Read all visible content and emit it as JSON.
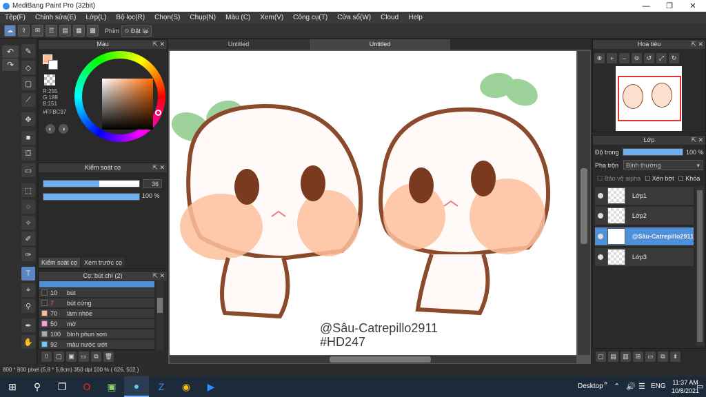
{
  "window": {
    "title": "MediBang Paint Pro (32bit)",
    "minimize": "—",
    "maximize": "❐",
    "close": "✕"
  },
  "menu": [
    "Tệp(F)",
    "Chỉnh sửa(E)",
    "Lớp(L)",
    "Bộ lọc(R)",
    "Chọn(S)",
    "Chụp(N)",
    "Màu (C)",
    "Xem(V)",
    "Công cụ(T)",
    "Cửa sổ(W)",
    "Cloud",
    "Help"
  ],
  "toolbar": {
    "snap_label": "Phím",
    "snap_button": "Đặt lại"
  },
  "color_panel": {
    "title": "Màu",
    "r": "R:255",
    "g": "G:188",
    "b": "B:151",
    "hex": "#FFBC97",
    "primary_color": "#FFBC97"
  },
  "brush_control": {
    "title": "Kiểm soát cọ",
    "size_value": "36",
    "size_fraction": 0.58,
    "opacity_value": "100 %",
    "opacity_fraction": 1.0
  },
  "tabs": [
    "Kiểm soát cọ",
    "Xem trước cọ"
  ],
  "brush_list": {
    "title": "Cọ: bút chì (2)",
    "items": [
      {
        "size": "10",
        "name": "bút",
        "color": "#333333",
        "size_color": "#dddddd"
      },
      {
        "size": "7",
        "name": "bút cứng",
        "color": "#333333",
        "size_color": "#ff5555"
      },
      {
        "size": "70",
        "name": "làm nhòe",
        "color": "#ffbc97",
        "size_color": "#dddddd"
      },
      {
        "size": "50",
        "name": "mờ",
        "color": "#ff99dd",
        "size_color": "#dddddd"
      },
      {
        "size": "100",
        "name": "bình phun sơn",
        "color": "#aaaaaa",
        "size_color": "#dddddd"
      },
      {
        "size": "92",
        "name": "màu nước ướt",
        "color": "#66ccff",
        "size_color": "#dddddd"
      }
    ]
  },
  "doc_tabs": [
    "Untitled",
    "Untitled"
  ],
  "canvas_text": {
    "line1": "@Sâu-Catrepillo2911",
    "line2": "#HD247"
  },
  "navigator": {
    "title": "Hoa tiêu"
  },
  "layer_panel": {
    "title": "Lớp",
    "opacity_label": "Độ trong",
    "opacity_value": "100 %",
    "opacity_fraction": 1.0,
    "blend_label": "Pha trộn",
    "blend_value": "Bình thường",
    "protect_alpha": "Bảo vệ alpha",
    "clipping": "Xén bớt",
    "lock": "Khóa",
    "layers": [
      {
        "name": "Lớp1",
        "selected": false
      },
      {
        "name": "Lớp2",
        "selected": false
      },
      {
        "name": "@Sâu-Catrepillo2911",
        "selected": true
      },
      {
        "name": "Lớp3",
        "selected": false
      }
    ]
  },
  "status": "800 * 800 pixel  (5.8 * 5.8cm)  350 dpi  100 %  ( 626, 502 )",
  "taskbar": {
    "desktop": "Desktop",
    "lang": "ENG",
    "time": "11:37 AM",
    "date": "10/8/2021"
  }
}
